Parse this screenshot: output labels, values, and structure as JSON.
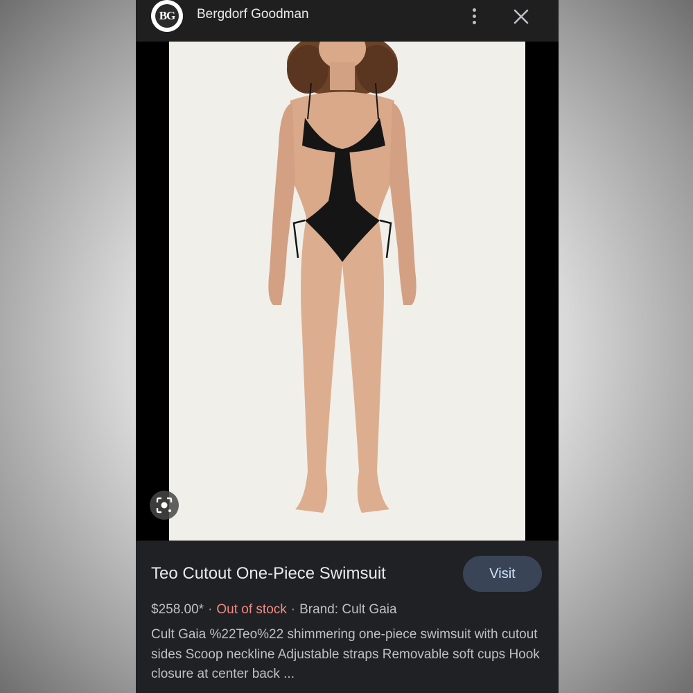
{
  "header": {
    "logo_text": "BG",
    "site_name": "Bergdorf Goodman",
    "more_icon": "more-vert-icon",
    "close_icon": "close-icon"
  },
  "image": {
    "lens_icon": "google-lens-icon",
    "background_color": "#f1efea"
  },
  "product": {
    "title": "Teo Cutout One-Piece Swimsuit",
    "visit_label": "Visit",
    "price": "$258.00*",
    "separator": "·",
    "stock_status": "Out of stock",
    "brand": "Brand: Cult Gaia",
    "description": "Cult Gaia %22Teo%22 shimmering one-piece swimsuit with cutout sides Scoop neckline Adjustable straps Removable soft cups Hook closure at center back ..."
  },
  "colors": {
    "out_of_stock": "#f28b82",
    "visit_button_bg": "#394457",
    "panel_bg": "#202124"
  }
}
